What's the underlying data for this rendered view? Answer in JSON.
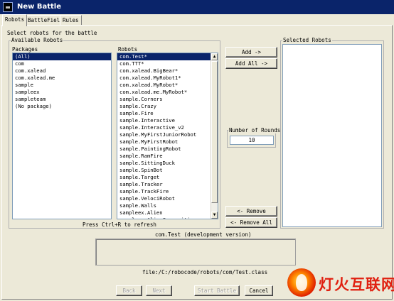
{
  "window": {
    "title": "New Battle"
  },
  "tabs": [
    {
      "label": "Robots"
    },
    {
      "label": "BattleField"
    },
    {
      "label": "Rules"
    }
  ],
  "instructions": "Select robots for the battle",
  "available_group": {
    "title": "Available Robots"
  },
  "packages": {
    "header": "Packages",
    "selected": "(All)",
    "items": [
      "(All)",
      "com",
      "com.xalead",
      "com.xalead.me",
      "sample",
      "sampleex",
      "sampleteam",
      "(No package)"
    ]
  },
  "robots": {
    "header": "Robots",
    "selected": "com.Test*",
    "items": [
      "com.Test*",
      "com.TTT*",
      "com.xalead.BigBear*",
      "com.xalead.MyRobot1*",
      "com.xalead.MyRobot*",
      "com.xalead.me.MyRobot*",
      "sample.Corners",
      "sample.Crazy",
      "sample.Fire",
      "sample.Interactive",
      "sample.Interactive_v2",
      "sample.MyFirstJuniorRobot",
      "sample.MyFirstRobot",
      "sample.PaintingRobot",
      "sample.RamFire",
      "sample.SittingDuck",
      "sample.SpinBot",
      "sample.Target",
      "sample.Tracker",
      "sample.TrackFire",
      "sample.VelociRobot",
      "sample.Walls",
      "sampleex.Alien",
      "sampleex.AlienComposition"
    ]
  },
  "buttons": {
    "add": "Add ->",
    "add_all": "Add All ->",
    "remove": "<- Remove",
    "remove_all": "<- Remove All",
    "back": "Back",
    "next": "Next",
    "start_battle": "Start Battle",
    "cancel": "Cancel"
  },
  "rounds": {
    "label": "Number of Rounds",
    "value": "10"
  },
  "selected_group": {
    "title": "Selected Robots"
  },
  "refresh_hint": "Press Ctrl+R to refresh",
  "description": {
    "title": "com.Test (development version)",
    "body": "",
    "path": "file:/C:/robocode/robots/com/Test.class"
  },
  "watermark": {
    "text": "灯火互联网"
  }
}
